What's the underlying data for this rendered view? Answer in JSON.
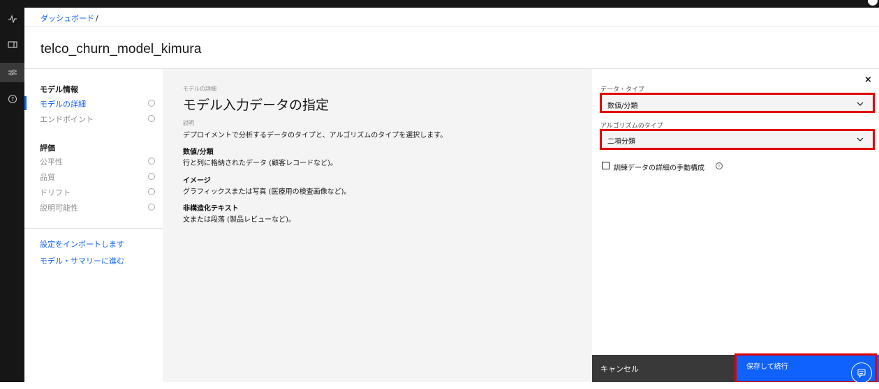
{
  "breadcrumb": {
    "root": "ダッシュボード",
    "separator": "/"
  },
  "page": {
    "title": "telco_churn_model_kimura"
  },
  "rail": {
    "icons": [
      "activity-icon",
      "catalog-icon",
      "settings-sliders-icon",
      "help-icon"
    ]
  },
  "sidebar": {
    "section_model": "モデル情報",
    "model_items": [
      {
        "label": "モデルの詳細",
        "active": true
      },
      {
        "label": "エンドポイント",
        "active": false
      }
    ],
    "section_eval": "評価",
    "eval_items": [
      {
        "label": "公平性"
      },
      {
        "label": "品質"
      },
      {
        "label": "ドリフト"
      },
      {
        "label": "説明可能性"
      }
    ],
    "links": [
      {
        "label": "設定をインポートします"
      },
      {
        "label": "モデル・サマリーに進む"
      }
    ]
  },
  "main": {
    "eyebrow": "モデルの詳細",
    "title": "モデル入力データの指定",
    "desc_label": "説明",
    "desc": "デプロイメントで分析するデータのタイプと、アルゴリズムのタイプを選択します。",
    "types": [
      {
        "heading": "数値/分類",
        "text": "行と列に格納されたデータ (顧客レコードなど)。"
      },
      {
        "heading": "イメージ",
        "text": "グラフィックスまたは写真 (医療用の検査画像など)。"
      },
      {
        "heading": "非構造化テキスト",
        "text": "文または段落 (製品レビューなど)。"
      }
    ]
  },
  "form": {
    "close": "×",
    "data_type_label": "データ・タイプ",
    "data_type_value": "数値/分類",
    "algo_label": "アルゴリズムのタイプ",
    "algo_value": "二項分類",
    "manual_config_label": "訓練データの詳細の手動構成",
    "info_glyph": "i"
  },
  "footer": {
    "cancel": "キャンセル",
    "save": "保存して続行"
  },
  "colors": {
    "accent": "#0f62fe",
    "highlight": "#e00000",
    "dark": "#161616"
  }
}
